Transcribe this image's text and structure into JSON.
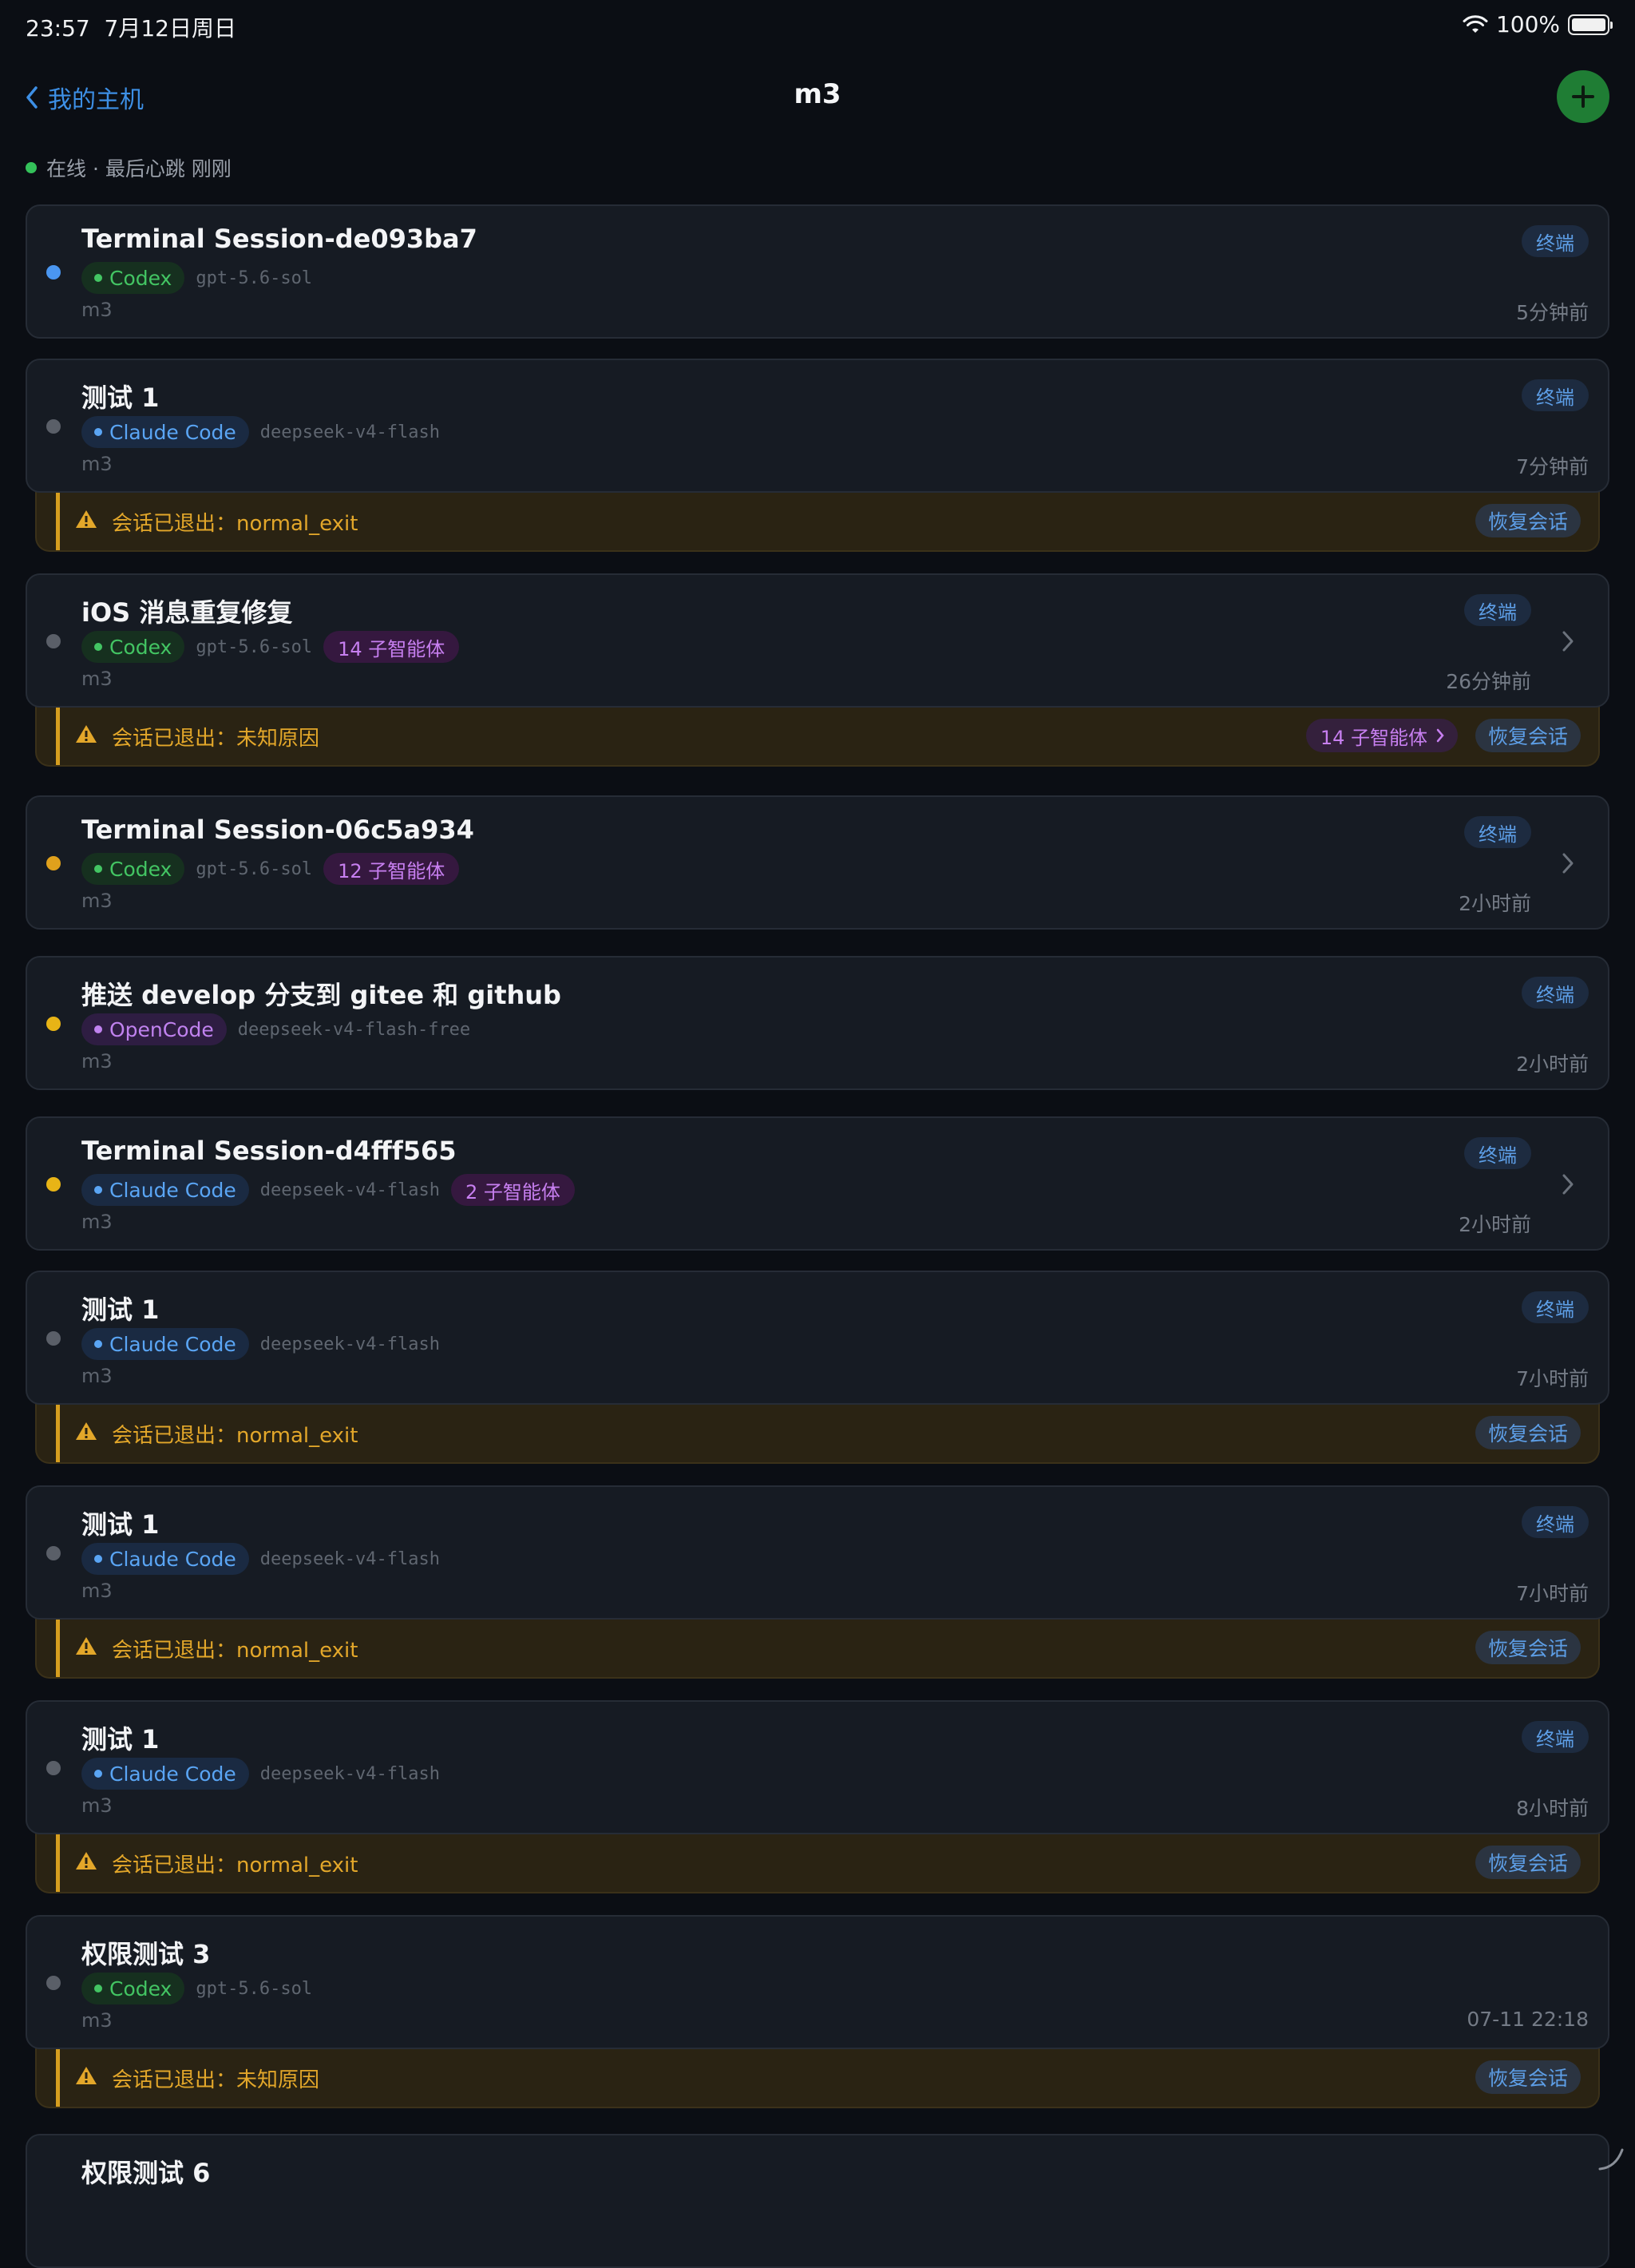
{
  "status": {
    "time": "23:57",
    "date": "7月12日周日",
    "battery": "100%"
  },
  "nav": {
    "back_label": "我的主机",
    "title": "m3"
  },
  "host_status": "在线 · 最后心跳 刚刚",
  "colors": {
    "accent": "#3d8fe5",
    "online": "#34c15a",
    "warning": "#e3a72a",
    "add": "#1f7d34"
  },
  "sessions": [
    {
      "title": "Terminal Session-de093ba7",
      "agent": "Codex",
      "model": "gpt-5.6-sol",
      "subagents": "",
      "host": "m3",
      "time": "5分钟前",
      "term": "终端",
      "status_color": "#4a96f0"
    },
    {
      "title": "测试 1",
      "agent": "Claude Code",
      "model": "deepseek-v4-flash",
      "subagents": "",
      "host": "m3",
      "time": "7分钟前",
      "term": "终端",
      "status_color": "#5a5f68",
      "banner": {
        "msg": "会话已退出：normal_exit",
        "restore": "恢复会话"
      }
    },
    {
      "title": "iOS 消息重复修复",
      "agent": "Codex",
      "model": "gpt-5.6-sol",
      "subagents": "14 子智能体",
      "host": "m3",
      "time": "26分钟前",
      "term": "终端",
      "status_color": "#5a5f68",
      "banner": {
        "msg": "会话已退出：未知原因",
        "restore": "恢复会话",
        "subagents": "14 子智能体"
      }
    },
    {
      "title": "Terminal Session-06c5a934",
      "agent": "Codex",
      "model": "gpt-5.6-sol",
      "subagents": "12 子智能体",
      "host": "m3",
      "time": "2小时前",
      "term": "终端",
      "status_color": "#e0a11c"
    },
    {
      "title": "推送 develop 分支到 gitee 和 github",
      "agent": "OpenCode",
      "model": "deepseek-v4-flash-free",
      "subagents": "",
      "host": "m3",
      "time": "2小时前",
      "term": "终端",
      "status_color": "#e8b416"
    },
    {
      "title": "Terminal Session-d4fff565",
      "agent": "Claude Code",
      "model": "deepseek-v4-flash",
      "subagents": "2 子智能体",
      "host": "m3",
      "time": "2小时前",
      "term": "终端",
      "status_color": "#e8b416"
    },
    {
      "title": "测试 1",
      "agent": "Claude Code",
      "model": "deepseek-v4-flash",
      "subagents": "",
      "host": "m3",
      "time": "7小时前",
      "term": "终端",
      "status_color": "#5a5f68",
      "banner": {
        "msg": "会话已退出：normal_exit",
        "restore": "恢复会话"
      }
    },
    {
      "title": "测试 1",
      "agent": "Claude Code",
      "model": "deepseek-v4-flash",
      "subagents": "",
      "host": "m3",
      "time": "7小时前",
      "term": "终端",
      "status_color": "#5a5f68",
      "banner": {
        "msg": "会话已退出：normal_exit",
        "restore": "恢复会话"
      }
    },
    {
      "title": "测试 1",
      "agent": "Claude Code",
      "model": "deepseek-v4-flash",
      "subagents": "",
      "host": "m3",
      "time": "8小时前",
      "term": "终端",
      "status_color": "#5a5f68",
      "banner": {
        "msg": "会话已退出：normal_exit",
        "restore": "恢复会话"
      }
    },
    {
      "title": "权限测试 3",
      "agent": "Codex",
      "model": "gpt-5.6-sol",
      "subagents": "",
      "host": "m3",
      "time": "07-11 22:18",
      "term": "",
      "status_color": "#5a5f68",
      "banner": {
        "msg": "会话已退出：未知原因",
        "restore": "恢复会话"
      }
    },
    {
      "title": "权限测试 6"
    }
  ]
}
